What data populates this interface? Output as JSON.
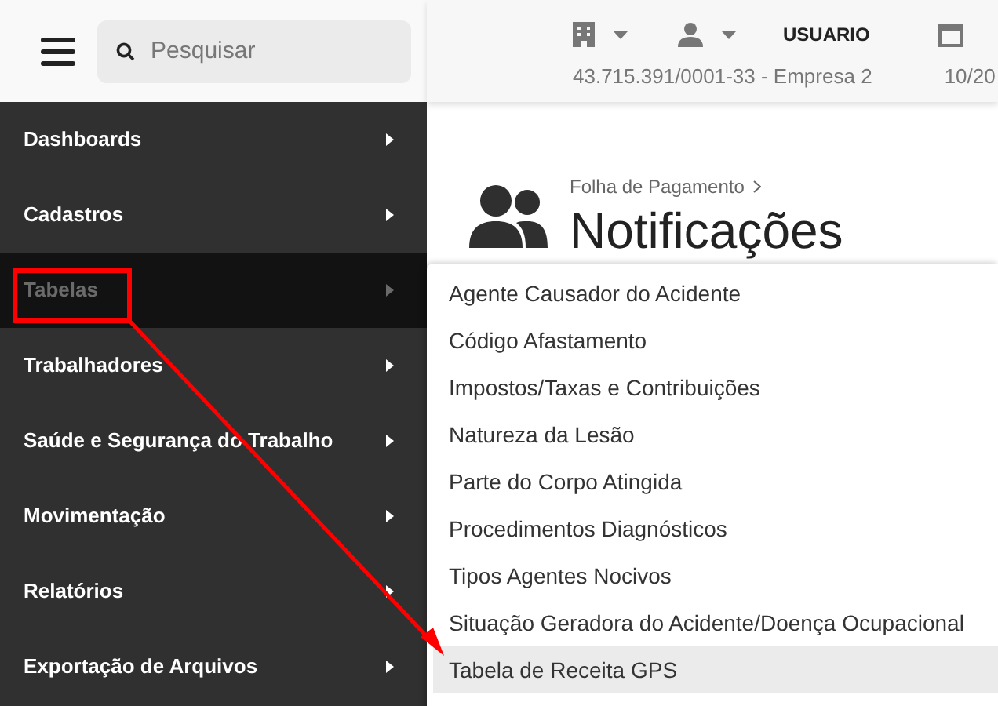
{
  "header": {
    "search": {
      "placeholder": "Pesquisar"
    },
    "user": "USUARIO",
    "company": "43.715.391/0001-33 - Empresa 2",
    "date": "10/20"
  },
  "sidebar": {
    "items": [
      {
        "label": "Dashboards",
        "selected": false
      },
      {
        "label": "Cadastros",
        "selected": false
      },
      {
        "label": "Tabelas",
        "selected": true
      },
      {
        "label": "Trabalhadores",
        "selected": false
      },
      {
        "label": "Saúde e Segurança do Trabalho",
        "selected": false
      },
      {
        "label": "Movimentação",
        "selected": false
      },
      {
        "label": "Relatórios",
        "selected": false
      },
      {
        "label": "Exportação de Arquivos",
        "selected": false
      }
    ]
  },
  "page": {
    "breadcrumb": "Folha de Pagamento",
    "title": "Notificações"
  },
  "submenu": {
    "items": [
      {
        "label": "Agente Causador do Acidente",
        "selected": false
      },
      {
        "label": "Código Afastamento",
        "selected": false
      },
      {
        "label": "Impostos/Taxas e Contribuições",
        "selected": false
      },
      {
        "label": "Natureza da Lesão",
        "selected": false
      },
      {
        "label": "Parte do Corpo Atingida",
        "selected": false
      },
      {
        "label": "Procedimentos Diagnósticos",
        "selected": false
      },
      {
        "label": "Tipos Agentes Nocivos",
        "selected": false
      },
      {
        "label": "Situação Geradora do Acidente/Doença Ocupacional",
        "selected": false
      },
      {
        "label": "Tabela de Receita GPS",
        "selected": true
      }
    ]
  }
}
